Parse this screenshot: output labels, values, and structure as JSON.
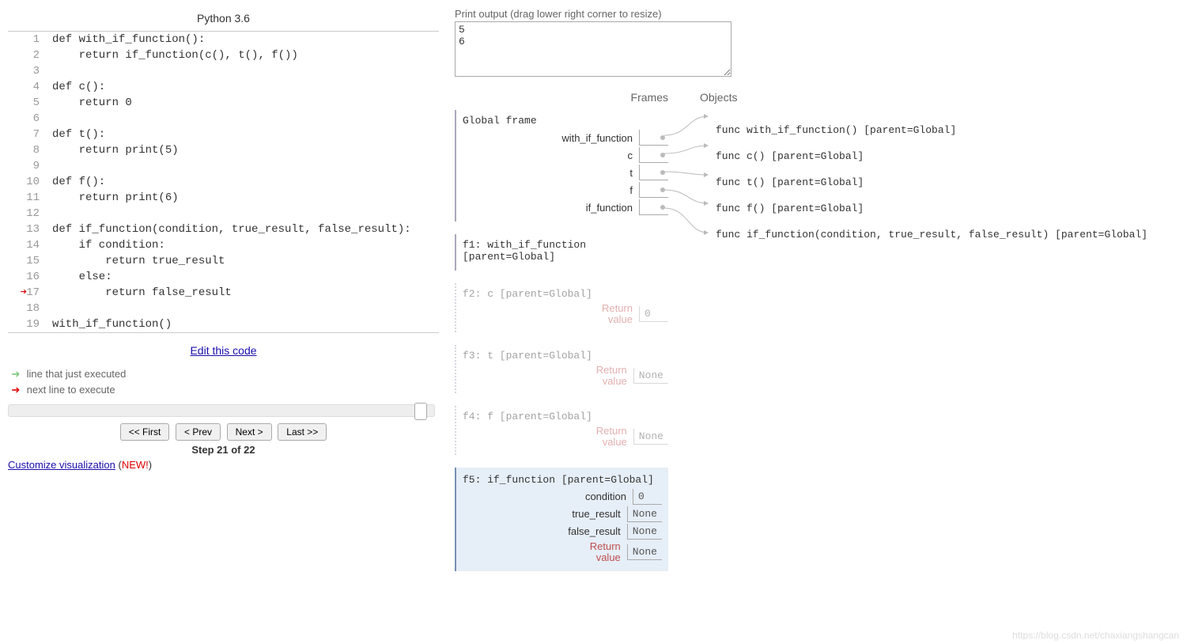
{
  "title": "Python 3.6",
  "code": {
    "lines": [
      {
        "n": "1",
        "t": "def with_if_function():"
      },
      {
        "n": "2",
        "t": "    return if_function(c(), t(), f())"
      },
      {
        "n": "3",
        "t": ""
      },
      {
        "n": "4",
        "t": "def c():"
      },
      {
        "n": "5",
        "t": "    return 0"
      },
      {
        "n": "6",
        "t": ""
      },
      {
        "n": "7",
        "t": "def t():"
      },
      {
        "n": "8",
        "t": "    return print(5)"
      },
      {
        "n": "9",
        "t": ""
      },
      {
        "n": "10",
        "t": "def f():"
      },
      {
        "n": "11",
        "t": "    return print(6)"
      },
      {
        "n": "12",
        "t": ""
      },
      {
        "n": "13",
        "t": "def if_function(condition, true_result, false_result):"
      },
      {
        "n": "14",
        "t": "    if condition:"
      },
      {
        "n": "15",
        "t": "        return true_result"
      },
      {
        "n": "16",
        "t": "    else:"
      },
      {
        "n": "17",
        "t": "        return false_result"
      },
      {
        "n": "18",
        "t": ""
      },
      {
        "n": "19",
        "t": "with_if_function()"
      }
    ],
    "next_line": 17
  },
  "edit_link": "Edit this code",
  "legend": {
    "just_executed": "line that just executed",
    "next_line": "next line to execute"
  },
  "nav": {
    "first": "<< First",
    "prev": "< Prev",
    "next": "Next >",
    "last": "Last >>"
  },
  "step_label": "Step 21 of 22",
  "customize": {
    "text": "Customize visualization",
    "badge": "NEW!"
  },
  "print": {
    "label": "Print output (drag lower right corner to resize)",
    "content": "5\n6"
  },
  "headers": {
    "frames": "Frames",
    "objects": "Objects"
  },
  "frames": {
    "global": {
      "title": "Global frame",
      "vars": [
        "with_if_function",
        "c",
        "t",
        "f",
        "if_function"
      ]
    },
    "f1": {
      "title": "f1: with_if_function [parent=Global]"
    },
    "f2": {
      "title": "f2: c [parent=Global]",
      "ret_label": "Return\nvalue",
      "ret_val": "0"
    },
    "f3": {
      "title": "f3: t [parent=Global]",
      "ret_label": "Return\nvalue",
      "ret_val": "None"
    },
    "f4": {
      "title": "f4: f [parent=Global]",
      "ret_label": "Return\nvalue",
      "ret_val": "None"
    },
    "f5": {
      "title": "f5: if_function [parent=Global]",
      "vars": [
        {
          "label": "condition",
          "val": "0"
        },
        {
          "label": "true_result",
          "val": "None"
        },
        {
          "label": "false_result",
          "val": "None"
        }
      ],
      "ret_label": "Return\nvalue",
      "ret_val": "None"
    }
  },
  "objects": [
    "func with_if_function() [parent=Global]",
    "func c() [parent=Global]",
    "func t() [parent=Global]",
    "func f() [parent=Global]",
    "func if_function(condition, true_result, false_result) [parent=Global]"
  ],
  "watermark": "https://blog.csdn.net/chaxiangshangcan"
}
